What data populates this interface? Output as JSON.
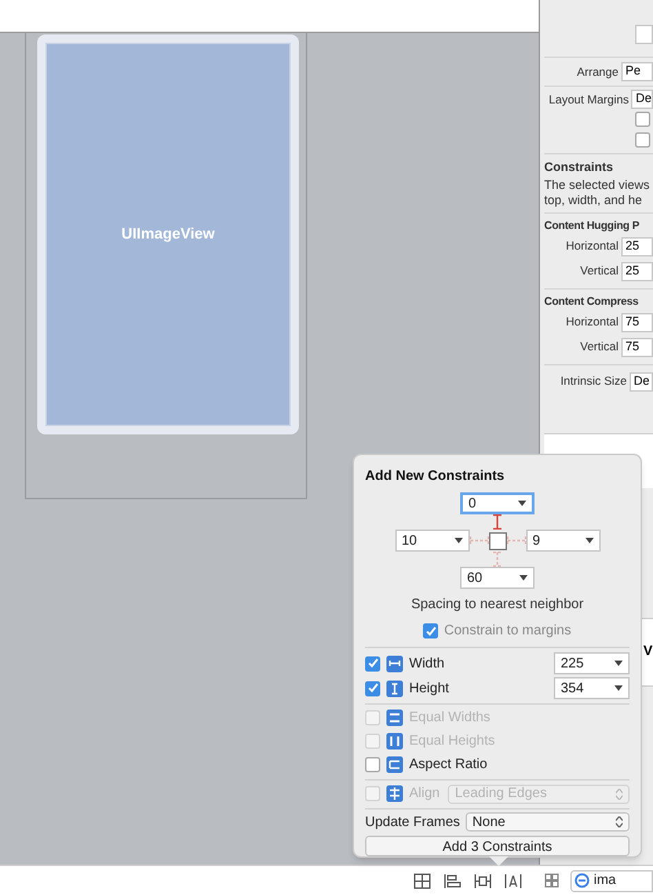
{
  "canvas": {
    "image_view_label": "UIImageView"
  },
  "inspector": {
    "arrange": {
      "label": "Arrange",
      "value": "Pe"
    },
    "layout_margins": {
      "label": "Layout Margins",
      "value": "De"
    },
    "margin_options": [
      {
        "checked": false
      },
      {
        "checked": false
      }
    ],
    "constraints": {
      "title": "Constraints",
      "lines": [
        "The selected views",
        "top, width, and he"
      ]
    },
    "hugging": {
      "title": "Content Hugging P",
      "rows": [
        {
          "label": "Horizontal",
          "value": "25"
        },
        {
          "label": "Vertical",
          "value": "25"
        }
      ]
    },
    "compression": {
      "title": "Content Compress",
      "rows": [
        {
          "label": "Horizontal",
          "value": "75"
        },
        {
          "label": "Vertical",
          "value": "75"
        }
      ]
    },
    "intrinsic_size": {
      "label": "Intrinsic Size",
      "value": "De"
    },
    "library_item": {
      "title": "V"
    }
  },
  "popover": {
    "title": "Add New Constraints",
    "spacing": {
      "top": {
        "value": "0",
        "active": true,
        "focused": true
      },
      "left": {
        "value": "10",
        "active": false,
        "focused": false
      },
      "right": {
        "value": "9",
        "active": false,
        "focused": false
      },
      "bottom": {
        "value": "60",
        "active": false,
        "focused": false
      }
    },
    "spacing_caption": "Spacing to nearest neighbor",
    "constrain_to_margins": {
      "label": "Constrain to margins",
      "checked": true
    },
    "size_rows": [
      {
        "kind": "width",
        "label": "Width",
        "checked": true,
        "value": "225"
      },
      {
        "kind": "height",
        "label": "Height",
        "checked": true,
        "value": "354"
      }
    ],
    "options": [
      {
        "kind": "widths",
        "label": "Equal Widths",
        "checked": false,
        "disabled": true
      },
      {
        "kind": "heights",
        "label": "Equal Heights",
        "checked": false,
        "disabled": true
      },
      {
        "kind": "aspect",
        "label": "Aspect Ratio",
        "checked": false,
        "disabled": false
      }
    ],
    "align": {
      "label": "Align",
      "value": "Leading Edges",
      "checked": false,
      "disabled": true
    },
    "update_frames": {
      "label": "Update Frames",
      "value": "None"
    },
    "add_button": "Add 3 Constraints"
  },
  "search": {
    "value": "ima"
  }
}
